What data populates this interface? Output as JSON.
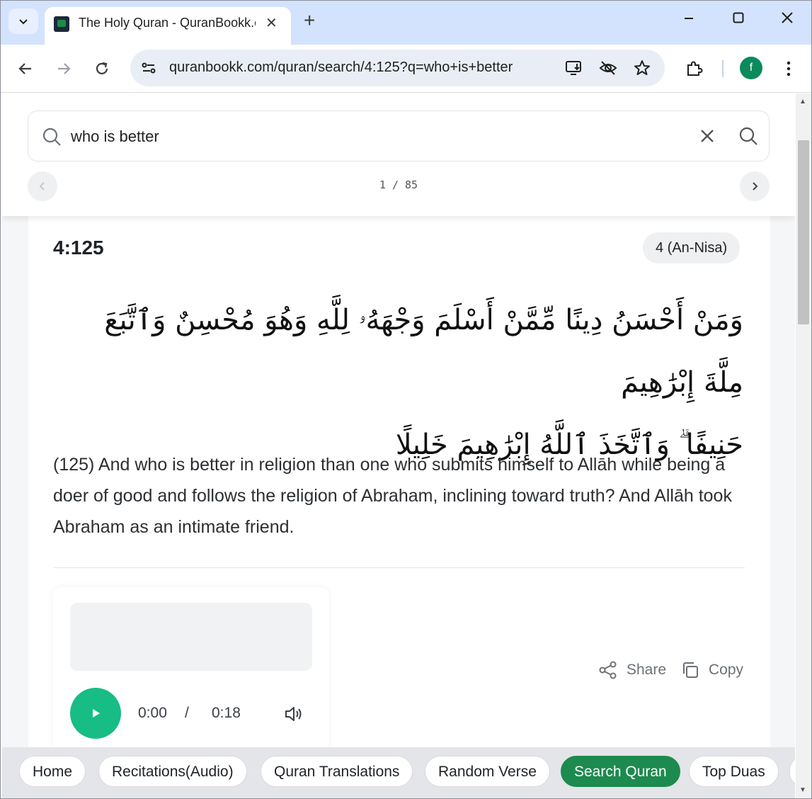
{
  "browser": {
    "tab_title": "The Holy Quran - QuranBookk.com",
    "url": "quranbookk.com/quran/search/4:125?q=who+is+better",
    "profile_initial": "f"
  },
  "search": {
    "query": "who is better",
    "pager": "1 / 85"
  },
  "verse": {
    "reference": "4:125",
    "surah": "4 (An-Nisa)",
    "arabic_line1": "وَمَنْ أَحْسَنُ دِينًا مِّمَّنْ أَسْلَمَ وَجْهَهُۥ لِلَّهِ وَهُوَ مُحْسِنٌ وَٱتَّبَعَ مِلَّةَ إِبْرَٰهِيمَ",
    "arabic_line2": "حَنِيفًا ۗ وَٱتَّخَذَ ٱللَّهُ إِبْرَٰهِيمَ خَلِيلًا",
    "translation": "(125) And who is better in religion than one who submits himself to Allāh while being a doer of good and follows the religion of Abraham, inclining toward truth? And Allāh took Abraham as an intimate friend."
  },
  "audio": {
    "current_time": "0:00",
    "separator": "/",
    "duration": "0:18"
  },
  "actions": {
    "share": "Share",
    "copy": "Copy"
  },
  "bottom_nav": {
    "items": [
      "Home",
      "Recitations(Audio)",
      "Quran Translations",
      "Random Verse",
      "Search Quran",
      "Top Duas"
    ],
    "active": "Search Quran"
  },
  "colors": {
    "accent_green": "#1d8a4f",
    "play_green": "#17bd84",
    "tabbar": "#d3e3fd"
  }
}
